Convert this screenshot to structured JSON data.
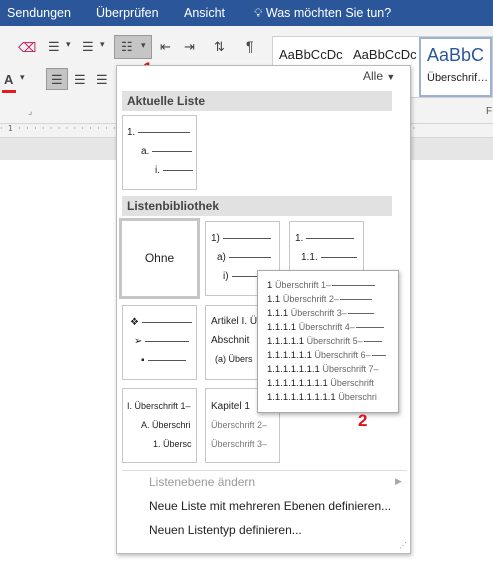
{
  "tabs": [
    "Sendungen",
    "Überprüfen",
    "Ansicht"
  ],
  "tell_me": "Was möchten Sie tun?",
  "ribbon": {
    "styles": [
      "AaBbCcDc",
      "AaBbCcDc",
      "AaBbC"
    ],
    "style_caption": "Überschrif…",
    "group_label": "F"
  },
  "menu": {
    "filter": "Alle",
    "current_section": "Aktuelle Liste",
    "current_list": [
      "1.",
      "a.",
      "i."
    ],
    "library_section": "Listenbibliothek",
    "none_label": "Ohne",
    "lib_tile2": [
      "1)",
      "a)",
      "i)"
    ],
    "lib_tile3": [
      "1.",
      "1.1."
    ],
    "lib_tile4_bullets": [
      "❖",
      "➢",
      "▪"
    ],
    "lib_tile5": [
      "Artikel I. Üb",
      "Abschnit",
      "(a) Übers"
    ],
    "lib_tile6": [
      "I. Überschrift 1–",
      "A. Überschri",
      "1. Übersc"
    ],
    "lib_tile7": [
      "Kapitel 1",
      "Überschrift 2–",
      "Überschrift 3–"
    ],
    "commands": [
      {
        "label": "Listenebene ändern",
        "enabled": false
      },
      {
        "label": "Neue Liste mit mehreren Ebenen definieren...",
        "enabled": true
      },
      {
        "label": "Neuen Listentyp definieren...",
        "enabled": true
      }
    ]
  },
  "preview": {
    "rows": [
      {
        "num": "1",
        "text": "Überschrift 1–"
      },
      {
        "num": "1.1",
        "text": "Überschrift 2–"
      },
      {
        "num": "1.1.1",
        "text": "Überschrift 3–"
      },
      {
        "num": "1.1.1.1",
        "text": "Überschrift 4–"
      },
      {
        "num": "1.1.1.1.1",
        "text": "Überschrift 5–"
      },
      {
        "num": "1.1.1.1.1.1",
        "text": "Überschrift 6–"
      },
      {
        "num": "1.1.1.1.1.1.1",
        "text": "Überschrift 7–"
      },
      {
        "num": "1.1.1.1.1.1.1.1",
        "text": "Überschrift"
      },
      {
        "num": "1.1.1.1.1.1.1.1.1",
        "text": "Überschri"
      }
    ]
  },
  "callouts": [
    "1",
    "2"
  ],
  "colors": {
    "accent": "#2b579a",
    "callout": "#e0101c"
  }
}
